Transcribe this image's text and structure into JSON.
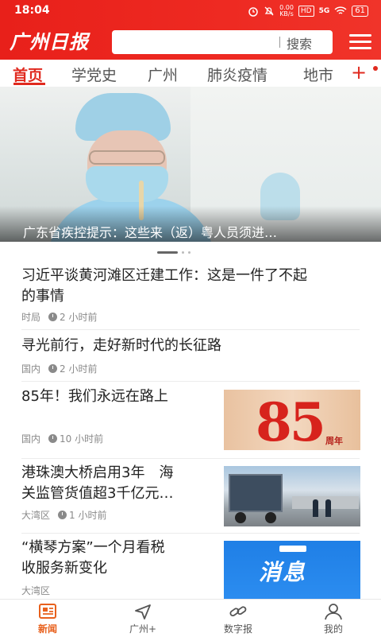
{
  "status_bar": {
    "time": "18:04",
    "speed": "0.00\nKB/s",
    "hd": "HD",
    "signal": "5G",
    "battery": "61",
    "icons": [
      "alarm-icon",
      "mute-icon",
      "wifi-icon",
      "battery-icon"
    ]
  },
  "header": {
    "logo": "广州日报",
    "search_button": "搜索",
    "search_placeholder": ""
  },
  "tabs": {
    "items": [
      "首页",
      "学党史",
      "广州",
      "肺炎疫情",
      "地市"
    ],
    "active": "首页"
  },
  "hero": {
    "caption": "广东省疾控提示：这些来（返）粤人员须进…"
  },
  "news": [
    {
      "title_line1": "习近平谈黄河滩区迁建工作：这是一件了不起",
      "title_line2": "的事情",
      "source": "时局",
      "time": "2 小时前"
    },
    {
      "title_line1": "寻光前行，走好新时代的长征路",
      "source": "国内",
      "time": "2 小时前"
    },
    {
      "title_line1": "85年！我们永远在路上",
      "source": "国内",
      "time": "10 小时前",
      "thumb_number": "85",
      "thumb_suffix": "周年"
    },
    {
      "title_line1": "港珠澳大桥启用3年　海",
      "title_line2": "关监管货值超3千亿元…",
      "source": "大湾区",
      "time": "1 小时前"
    },
    {
      "title_line1": "“横琴方案”一个月看税",
      "title_line2": "收服务新变化",
      "source": "大湾区",
      "thumb_text": "消息"
    }
  ],
  "tabbar": {
    "items": [
      "新闻",
      "广州+",
      "数字报",
      "我的"
    ],
    "active": "新闻",
    "active_color": "#e8601c"
  },
  "colors": {
    "brand_red": "#e8201a",
    "accent": "#e02a1f"
  }
}
